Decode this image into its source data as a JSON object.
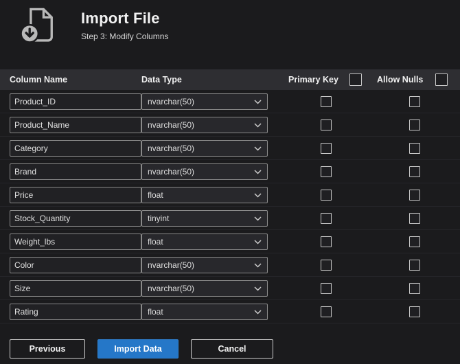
{
  "header": {
    "title": "Import File",
    "subtitle": "Step 3: Modify Columns"
  },
  "table": {
    "headers": {
      "column_name": "Column Name",
      "data_type": "Data Type",
      "primary_key": "Primary Key",
      "allow_nulls": "Allow Nulls"
    },
    "rows": [
      {
        "name": "Product_ID",
        "type": "nvarchar(50)",
        "primary_key": false,
        "allow_nulls": false
      },
      {
        "name": "Product_Name",
        "type": "nvarchar(50)",
        "primary_key": false,
        "allow_nulls": false
      },
      {
        "name": "Category",
        "type": "nvarchar(50)",
        "primary_key": false,
        "allow_nulls": false
      },
      {
        "name": "Brand",
        "type": "nvarchar(50)",
        "primary_key": false,
        "allow_nulls": false
      },
      {
        "name": "Price",
        "type": "float",
        "primary_key": false,
        "allow_nulls": false
      },
      {
        "name": "Stock_Quantity",
        "type": "tinyint",
        "primary_key": false,
        "allow_nulls": false
      },
      {
        "name": "Weight_lbs",
        "type": "float",
        "primary_key": false,
        "allow_nulls": false
      },
      {
        "name": "Color",
        "type": "nvarchar(50)",
        "primary_key": false,
        "allow_nulls": false
      },
      {
        "name": "Size",
        "type": "nvarchar(50)",
        "primary_key": false,
        "allow_nulls": false
      },
      {
        "name": "Rating",
        "type": "float",
        "primary_key": false,
        "allow_nulls": false
      }
    ]
  },
  "footer": {
    "previous_label": "Previous",
    "import_label": "Import Data",
    "cancel_label": "Cancel"
  },
  "colors": {
    "accent_blue": "#2577c8",
    "background": "#1b1b1d",
    "table_header_bg": "#2e2e32"
  },
  "icons": {
    "file_import": "document-with-download-arrow-icon",
    "dropdown": "chevron-down-icon"
  }
}
